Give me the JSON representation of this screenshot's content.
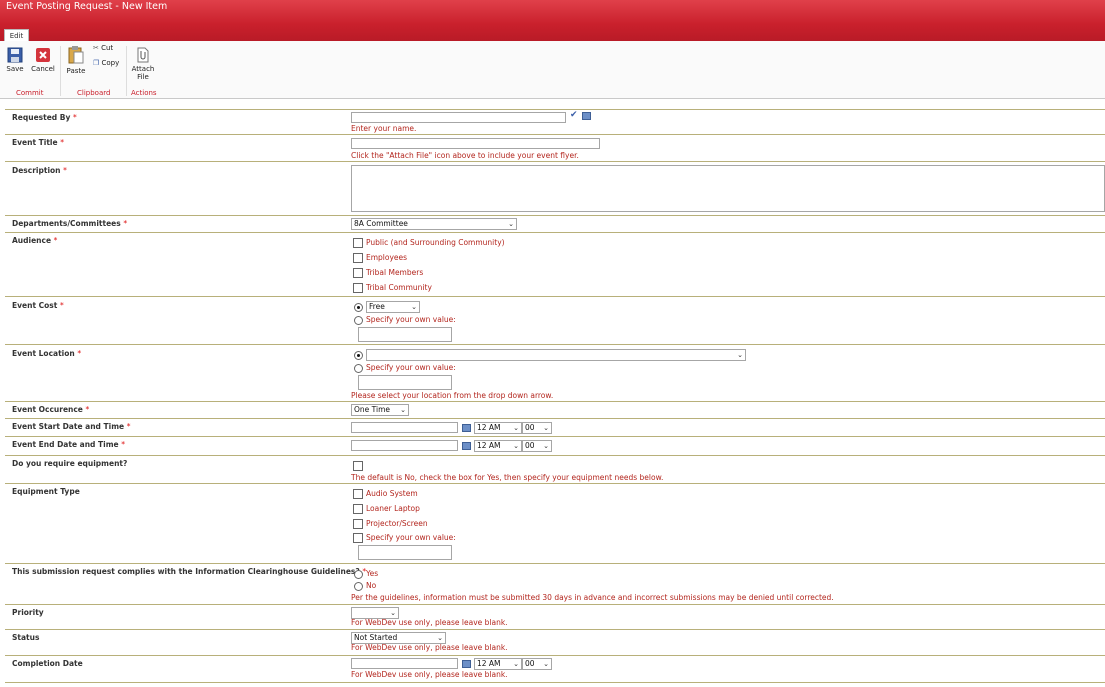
{
  "window": {
    "title": "Event Posting Request - New Item",
    "tab": "Edit"
  },
  "ribbon": {
    "save": "Save",
    "cancel": "Cancel",
    "paste": "Paste",
    "cut": "Cut",
    "copy": "Copy",
    "attach": "Attach File",
    "groups": {
      "commit": "Commit",
      "clipboard": "Clipboard",
      "actions": "Actions"
    }
  },
  "form": {
    "requested_by": {
      "label": "Requested By",
      "hint": "Enter your name."
    },
    "event_title": {
      "label": "Event Title",
      "hint": "Click the \"Attach File\" icon above to include your event flyer."
    },
    "description": {
      "label": "Description"
    },
    "departments": {
      "label": "Departments/Committees",
      "value": "8A Committee"
    },
    "audience": {
      "label": "Audience",
      "options": [
        "Public (and Surrounding Community)",
        "Employees",
        "Tribal Members",
        "Tribal Community"
      ]
    },
    "event_cost": {
      "label": "Event Cost",
      "value": "Free",
      "own_value": "Specify your own value:"
    },
    "event_location": {
      "label": "Event Location",
      "own_value": "Specify your own value:",
      "hint": "Please select your location from the drop down arrow."
    },
    "event_occurence": {
      "label": "Event Occurence",
      "value": "One Time"
    },
    "event_start": {
      "label": "Event Start Date and Time",
      "hour": "12 AM",
      "minute": "00"
    },
    "event_end": {
      "label": "Event End Date and Time",
      "hour": "12 AM",
      "minute": "00"
    },
    "equipment": {
      "label": "Do you require equipment?",
      "hint": "The default is No, check the box for Yes, then specify your equipment needs below."
    },
    "equipment_type": {
      "label": "Equipment Type",
      "options": [
        "Audio System",
        "Loaner Laptop",
        "Projector/Screen",
        "Specify your own value:"
      ]
    },
    "guidelines": {
      "label": "This submission request complies with the Information Clearinghouse Guidelines?",
      "yes": "Yes",
      "no": "No",
      "hint": "Per the guidelines, information must be submitted 30 days in advance and incorrect submissions may be denied until corrected."
    },
    "priority": {
      "label": "Priority",
      "hint": "For WebDev use only, please leave blank."
    },
    "status": {
      "label": "Status",
      "value": "Not Started",
      "hint": "For WebDev use only, please leave blank."
    },
    "completion": {
      "label": "Completion Date",
      "hour": "12 AM",
      "minute": "00",
      "hint": "For WebDev use only, please leave blank."
    }
  }
}
